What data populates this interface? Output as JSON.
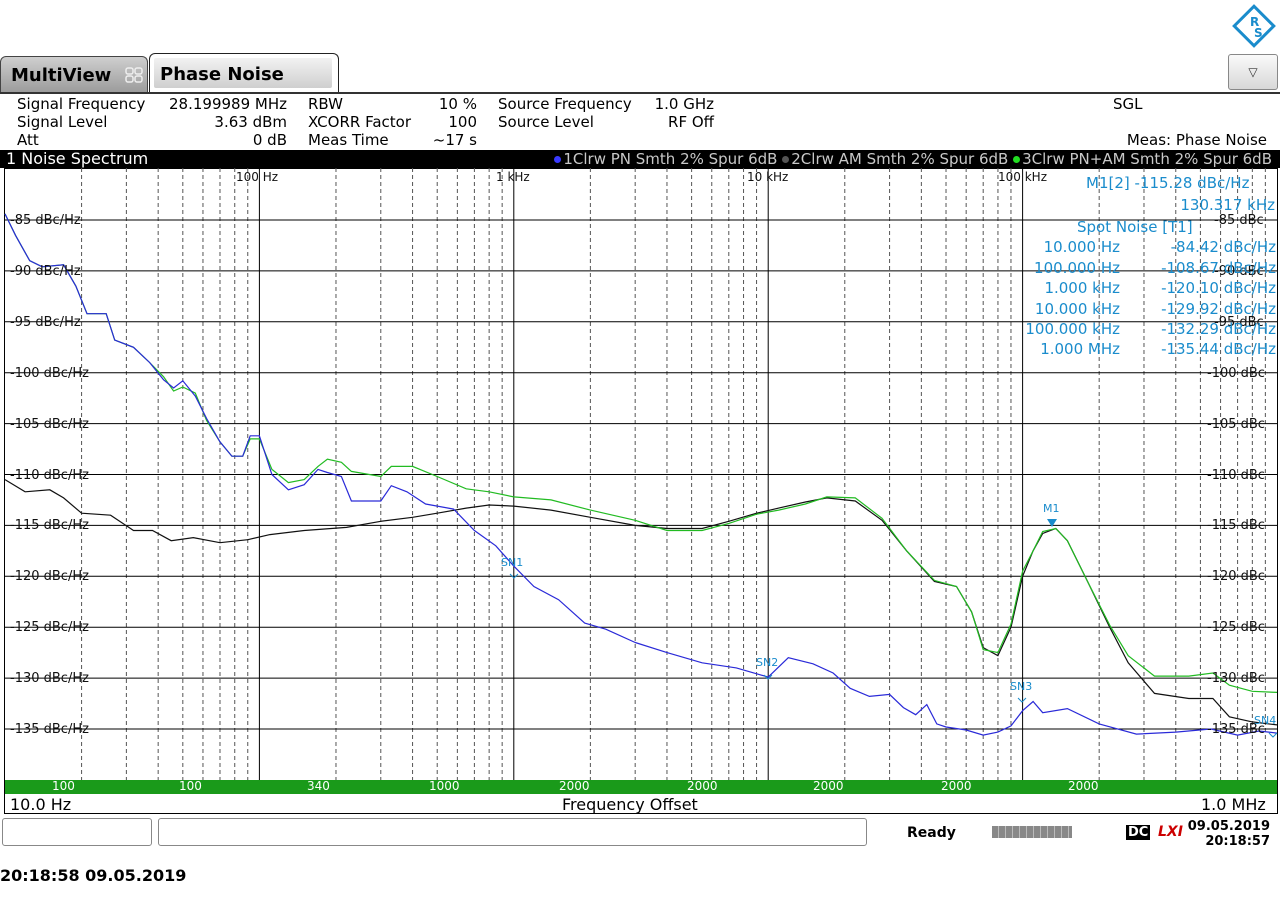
{
  "tabs": [
    {
      "label": "MultiView"
    },
    {
      "label": "Phase Noise"
    }
  ],
  "logo_text": "R&S",
  "settings": {
    "signal_frequency": {
      "label": "Signal Frequency",
      "value": "28.199989 MHz"
    },
    "signal_level": {
      "label": "Signal Level",
      "value": "3.63 dBm"
    },
    "att": {
      "label": "Att",
      "value": "0 dB"
    },
    "rbw": {
      "label": "RBW",
      "value": "10 %"
    },
    "xcorr": {
      "label": "XCORR Factor",
      "value": "100"
    },
    "meas_time": {
      "label": "Meas Time",
      "value": "~17 s"
    },
    "source_frequency": {
      "label": "Source Frequency",
      "value": "1.0 GHz"
    },
    "source_level": {
      "label": "Source Level",
      "value": "RF Off"
    },
    "sgl": "SGL",
    "meas": "Meas: Phase Noise"
  },
  "diagram": {
    "title": "1 Noise Spectrum",
    "traces": [
      {
        "label": "1Clrw PN Smth 2% Spur 6dB",
        "color": "#2a2ad8"
      },
      {
        "label": "2Clrw AM Smth 2% Spur 6dB",
        "color": "#222222"
      },
      {
        "label": "3Clrw PN+AM Smth 2% Spur 6dB",
        "color": "#22bb22"
      }
    ],
    "y_labels_left": [
      "-85 dBc/Hz",
      "-90 dBc/Hz",
      "-95 dBc/Hz",
      "-100 dBc/Hz",
      "-105 dBc/Hz",
      "-110 dBc/Hz",
      "-115 dBc/Hz",
      "-120 dBc/Hz",
      "-125 dBc/Hz",
      "-130 dBc/Hz",
      "-135 dBc/Hz"
    ],
    "y_labels_right": [
      "-85 dBc",
      "-90 dBc",
      "-95 dBc",
      "-100 dBc",
      "-105 dBc",
      "-110 dBc",
      "-115 dBc",
      "-120 dBc",
      "-125 dBc",
      "-130 dBc",
      "-135 dBc"
    ],
    "x_top_labels": [
      "100 Hz",
      "1 kHz",
      "10 kHz",
      "100 kHz"
    ],
    "marker_readout": {
      "m1_label": "M1[2]",
      "m1_level": "-115.28 dBc/Hz",
      "m1_freq": "130.317 kHz",
      "spot_title": "Spot Noise [T1]",
      "spot": [
        {
          "f": "10.000 Hz",
          "v": "-84.42 dBc/Hz"
        },
        {
          "f": "100.000 Hz",
          "v": "-108.67 dBc/Hz"
        },
        {
          "f": "1.000 kHz",
          "v": "-120.10 dBc/Hz"
        },
        {
          "f": "10.000 kHz",
          "v": "-129.92 dBc/Hz"
        },
        {
          "f": "100.000 kHz",
          "v": "-132.29 dBc/Hz"
        },
        {
          "f": "1.000 MHz",
          "v": "-135.44 dBc/Hz"
        }
      ]
    },
    "markers": {
      "m1": "M1",
      "sn1": "SN1",
      "sn2": "SN2",
      "sn3": "SN3",
      "sn4": "SN4"
    },
    "avg_bar": [
      "100",
      "100",
      "340",
      "1000",
      "2000",
      "2000",
      "2000",
      "2000",
      "2000"
    ],
    "x_start": "10.0 Hz",
    "x_center": "Frequency Offset",
    "x_stop": "1.0 MHz"
  },
  "status": {
    "ready": "Ready",
    "dc": "DC",
    "lxi": "LXI",
    "date": "09.05.2019",
    "time": "20:18:57"
  },
  "timestamp": "20:18:58  09.05.2019"
}
